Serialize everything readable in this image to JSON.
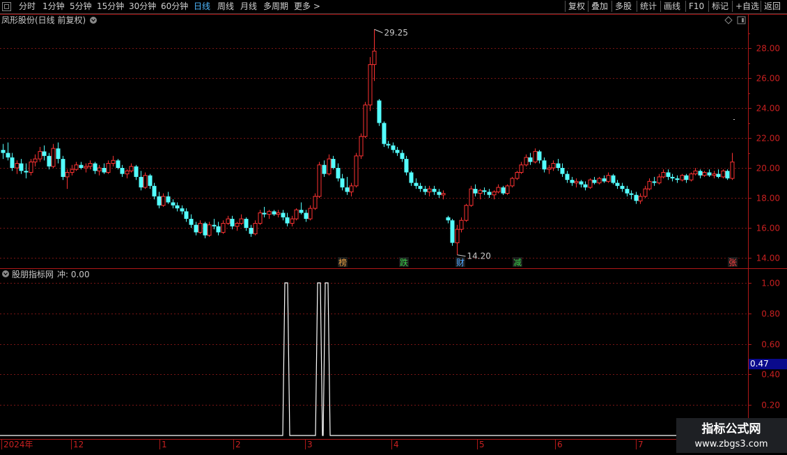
{
  "toolbar": {
    "periods": [
      "分时",
      "1分钟",
      "5分钟",
      "15分钟",
      "30分钟",
      "60分钟",
      "日线",
      "周线",
      "月线",
      "多周期",
      "更多 >"
    ],
    "active_period": "日线",
    "right_buttons": [
      "复权",
      "叠加",
      "多股",
      "统计",
      "画线",
      "F10",
      "标记",
      "+自选",
      "返回"
    ]
  },
  "main_chart": {
    "title": "凤形股份(日线 前复权)",
    "y_ticks": [
      "28.00",
      "26.00",
      "24.00",
      "22.00",
      "20.00",
      "18.00",
      "16.00",
      "14.00"
    ],
    "high_label": "29.25",
    "low_label": "14.20",
    "event_markers": [
      {
        "text": "榜",
        "color": "#e8a040"
      },
      {
        "text": "跌",
        "color": "#39d04a"
      },
      {
        "text": "财",
        "color": "#4da6ff"
      },
      {
        "text": "减",
        "color": "#39d04a"
      },
      {
        "text": "张",
        "color": "#ff4040"
      }
    ]
  },
  "indicator": {
    "title": "股朋指标网",
    "value_label": "冲: 0.00",
    "y_ticks": [
      "1.00",
      "0.80",
      "0.60",
      "0.40",
      "0.20"
    ],
    "cursor_value": "0.47",
    "spikes": [
      {
        "date": "2024-02-27",
        "value": 1.0
      },
      {
        "date": "2024-03-06",
        "value": 1.0
      },
      {
        "date": "2024-03-08",
        "value": 1.0
      }
    ]
  },
  "date_axis": [
    "2024年",
    "12",
    "1",
    "2",
    "3",
    "4",
    "5",
    "6",
    "7"
  ],
  "chart_data": {
    "type": "candlestick",
    "title": "凤形股份(日线 前复权)",
    "ylim": [
      13.3,
      30.0
    ],
    "high_label_value": 29.25,
    "low_label_value": 14.2,
    "ohlc": [
      [
        21.2,
        21.6,
        20.6,
        21.0
      ],
      [
        21.0,
        21.7,
        20.5,
        20.7
      ],
      [
        20.7,
        21.0,
        19.8,
        20.0
      ],
      [
        20.0,
        20.5,
        19.6,
        20.3
      ],
      [
        20.3,
        20.6,
        19.6,
        19.8
      ],
      [
        19.8,
        20.3,
        19.3,
        19.7
      ],
      [
        19.7,
        20.6,
        19.5,
        20.4
      ],
      [
        20.4,
        20.9,
        20.1,
        20.6
      ],
      [
        20.6,
        21.4,
        20.4,
        21.1
      ],
      [
        21.1,
        21.5,
        20.5,
        20.8
      ],
      [
        20.8,
        21.0,
        19.9,
        20.1
      ],
      [
        20.1,
        21.6,
        20.0,
        21.3
      ],
      [
        21.3,
        21.7,
        20.3,
        20.6
      ],
      [
        20.6,
        20.8,
        19.2,
        19.4
      ],
      [
        19.4,
        19.9,
        18.6,
        19.7
      ],
      [
        19.7,
        20.2,
        19.5,
        19.9
      ],
      [
        19.9,
        20.4,
        19.8,
        20.2
      ],
      [
        20.2,
        20.4,
        19.9,
        20.0
      ],
      [
        20.0,
        20.3,
        19.7,
        20.1
      ],
      [
        20.1,
        20.5,
        19.9,
        20.3
      ],
      [
        20.3,
        20.4,
        19.6,
        19.8
      ],
      [
        19.8,
        20.2,
        19.5,
        20.0
      ],
      [
        20.0,
        20.3,
        19.6,
        19.7
      ],
      [
        19.7,
        20.5,
        19.6,
        20.3
      ],
      [
        20.3,
        20.8,
        20.1,
        20.5
      ],
      [
        20.5,
        20.6,
        19.9,
        20.0
      ],
      [
        20.0,
        20.2,
        19.4,
        19.6
      ],
      [
        19.6,
        19.9,
        19.3,
        19.8
      ],
      [
        19.8,
        20.3,
        19.7,
        20.1
      ],
      [
        20.1,
        20.2,
        19.2,
        19.4
      ],
      [
        19.4,
        19.8,
        18.5,
        18.7
      ],
      [
        18.7,
        19.7,
        18.6,
        19.5
      ],
      [
        19.5,
        19.6,
        18.6,
        18.8
      ],
      [
        18.8,
        19.0,
        17.9,
        18.1
      ],
      [
        18.1,
        18.4,
        17.3,
        17.5
      ],
      [
        17.5,
        18.3,
        17.4,
        18.1
      ],
      [
        18.1,
        18.4,
        17.6,
        17.7
      ],
      [
        17.7,
        17.9,
        17.3,
        17.5
      ],
      [
        17.5,
        17.7,
        17.1,
        17.3
      ],
      [
        17.3,
        17.5,
        16.9,
        17.1
      ],
      [
        17.1,
        17.3,
        16.4,
        16.6
      ],
      [
        16.6,
        16.9,
        16.0,
        16.2
      ],
      [
        16.2,
        16.4,
        15.5,
        15.7
      ],
      [
        15.7,
        16.5,
        15.6,
        16.3
      ],
      [
        16.3,
        16.4,
        15.3,
        15.5
      ],
      [
        15.5,
        16.4,
        15.4,
        16.2
      ],
      [
        16.2,
        16.6,
        15.9,
        16.1
      ],
      [
        16.1,
        16.4,
        15.5,
        15.7
      ],
      [
        15.7,
        16.5,
        15.6,
        16.3
      ],
      [
        16.3,
        16.8,
        16.2,
        16.6
      ],
      [
        16.6,
        16.8,
        15.9,
        16.1
      ],
      [
        16.1,
        16.4,
        15.8,
        16.3
      ],
      [
        16.3,
        16.9,
        16.2,
        16.6
      ],
      [
        16.6,
        16.7,
        15.8,
        16.0
      ],
      [
        16.0,
        16.2,
        15.4,
        15.6
      ],
      [
        15.6,
        16.5,
        15.5,
        16.3
      ],
      [
        16.3,
        17.2,
        16.2,
        17.0
      ],
      [
        17.0,
        17.4,
        16.7,
        16.9
      ],
      [
        16.9,
        17.2,
        16.6,
        17.1
      ],
      [
        17.1,
        17.2,
        16.8,
        16.9
      ],
      [
        16.9,
        17.2,
        16.7,
        17.0
      ],
      [
        17.0,
        17.2,
        16.5,
        16.7
      ],
      [
        16.7,
        17.0,
        16.1,
        16.3
      ],
      [
        16.3,
        16.8,
        16.1,
        16.6
      ],
      [
        16.6,
        17.3,
        16.5,
        17.2
      ],
      [
        17.2,
        17.7,
        16.9,
        17.0
      ],
      [
        17.0,
        17.2,
        16.4,
        16.6
      ],
      [
        16.6,
        17.5,
        16.5,
        17.3
      ],
      [
        17.3,
        18.3,
        17.2,
        18.1
      ],
      [
        18.1,
        20.4,
        18.0,
        20.2
      ],
      [
        20.2,
        20.5,
        19.4,
        19.6
      ],
      [
        19.6,
        20.9,
        19.5,
        20.6
      ],
      [
        20.6,
        20.8,
        19.9,
        20.0
      ],
      [
        20.0,
        20.3,
        19.1,
        19.3
      ],
      [
        19.3,
        19.6,
        18.5,
        18.7
      ],
      [
        18.7,
        19.4,
        18.2,
        18.4
      ],
      [
        18.4,
        19.0,
        18.1,
        18.8
      ],
      [
        18.8,
        21.0,
        18.7,
        20.8
      ],
      [
        20.8,
        22.3,
        20.6,
        22.1
      ],
      [
        22.1,
        24.4,
        22.0,
        24.2
      ],
      [
        24.2,
        27.4,
        23.8,
        26.9
      ],
      [
        26.9,
        29.25,
        25.8,
        27.8
      ],
      [
        24.5,
        24.6,
        22.8,
        23.0
      ],
      [
        23.0,
        23.1,
        21.4,
        21.6
      ],
      [
        21.6,
        21.8,
        21.3,
        21.5
      ],
      [
        21.5,
        21.7,
        21.0,
        21.2
      ],
      [
        21.2,
        21.4,
        20.8,
        21.0
      ],
      [
        21.0,
        21.2,
        20.4,
        20.6
      ],
      [
        20.6,
        20.8,
        19.5,
        19.7
      ],
      [
        19.7,
        19.8,
        18.8,
        19.0
      ],
      [
        19.0,
        19.3,
        18.6,
        18.8
      ],
      [
        18.8,
        19.0,
        18.4,
        18.6
      ],
      [
        18.6,
        18.8,
        18.2,
        18.4
      ],
      [
        18.4,
        18.8,
        18.1,
        18.6
      ],
      [
        18.6,
        18.8,
        18.2,
        18.4
      ],
      [
        18.4,
        18.6,
        18.0,
        18.2
      ],
      [
        18.2,
        18.5,
        17.9,
        18.3
      ],
      [
        16.7,
        16.8,
        16.3,
        16.5
      ],
      [
        16.5,
        16.6,
        14.8,
        15.0
      ],
      [
        15.0,
        16.2,
        14.2,
        15.9
      ],
      [
        15.9,
        16.7,
        15.7,
        16.5
      ],
      [
        16.5,
        17.6,
        16.4,
        17.5
      ],
      [
        17.5,
        18.8,
        17.4,
        18.6
      ],
      [
        18.6,
        18.9,
        18.1,
        18.3
      ],
      [
        18.3,
        18.6,
        17.9,
        18.5
      ],
      [
        18.5,
        18.7,
        18.2,
        18.4
      ],
      [
        18.4,
        18.6,
        18.0,
        18.2
      ],
      [
        18.2,
        18.5,
        17.9,
        18.4
      ],
      [
        18.4,
        18.9,
        18.3,
        18.7
      ],
      [
        18.7,
        18.8,
        18.2,
        18.3
      ],
      [
        18.3,
        18.9,
        18.2,
        18.8
      ],
      [
        18.8,
        19.4,
        18.7,
        19.3
      ],
      [
        19.3,
        19.8,
        19.2,
        19.7
      ],
      [
        19.7,
        20.4,
        19.6,
        20.2
      ],
      [
        20.2,
        20.9,
        20.1,
        20.7
      ],
      [
        20.7,
        21.0,
        20.2,
        20.4
      ],
      [
        20.4,
        21.3,
        20.3,
        21.1
      ],
      [
        21.1,
        21.2,
        20.3,
        20.5
      ],
      [
        20.5,
        20.7,
        19.7,
        19.9
      ],
      [
        19.9,
        20.2,
        19.6,
        20.0
      ],
      [
        20.0,
        20.5,
        19.8,
        20.3
      ],
      [
        20.3,
        20.6,
        19.8,
        20.0
      ],
      [
        20.0,
        20.3,
        19.4,
        19.6
      ],
      [
        19.6,
        19.8,
        19.0,
        19.2
      ],
      [
        19.2,
        19.4,
        18.8,
        19.0
      ],
      [
        19.0,
        19.3,
        18.7,
        19.1
      ],
      [
        19.1,
        19.2,
        18.7,
        18.9
      ],
      [
        18.9,
        19.1,
        18.5,
        18.7
      ],
      [
        18.7,
        19.3,
        18.6,
        19.2
      ],
      [
        19.2,
        19.4,
        18.9,
        19.0
      ],
      [
        19.0,
        19.4,
        18.9,
        19.3
      ],
      [
        19.3,
        19.5,
        19.0,
        19.1
      ],
      [
        19.1,
        19.7,
        19.0,
        19.5
      ],
      [
        19.5,
        19.6,
        18.9,
        19.0
      ],
      [
        19.0,
        19.2,
        18.6,
        18.8
      ],
      [
        18.8,
        19.0,
        18.4,
        18.6
      ],
      [
        18.6,
        18.8,
        18.1,
        18.3
      ],
      [
        18.3,
        18.5,
        17.9,
        18.2
      ],
      [
        18.2,
        18.4,
        17.6,
        17.8
      ],
      [
        17.8,
        18.3,
        17.6,
        18.1
      ],
      [
        18.1,
        18.8,
        18.0,
        18.6
      ],
      [
        18.6,
        19.3,
        18.5,
        19.1
      ],
      [
        19.1,
        19.4,
        18.8,
        19.0
      ],
      [
        19.0,
        19.6,
        18.9,
        19.4
      ],
      [
        19.4,
        19.9,
        19.3,
        19.7
      ],
      [
        19.7,
        19.9,
        19.2,
        19.4
      ],
      [
        19.4,
        19.6,
        19.1,
        19.3
      ],
      [
        19.3,
        19.5,
        19.0,
        19.2
      ],
      [
        19.2,
        19.6,
        19.1,
        19.5
      ],
      [
        19.5,
        19.6,
        19.0,
        19.2
      ],
      [
        19.2,
        19.7,
        19.1,
        19.6
      ],
      [
        19.6,
        20.0,
        19.5,
        19.8
      ],
      [
        19.8,
        19.9,
        19.3,
        19.5
      ],
      [
        19.5,
        19.8,
        19.4,
        19.7
      ],
      [
        19.7,
        19.9,
        19.4,
        19.5
      ],
      [
        19.5,
        19.8,
        19.3,
        19.6
      ],
      [
        19.6,
        19.9,
        19.3,
        19.4
      ],
      [
        19.4,
        19.9,
        19.3,
        19.8
      ],
      [
        19.8,
        19.9,
        19.2,
        19.3
      ],
      [
        19.3,
        21.0,
        19.2,
        20.4
      ]
    ]
  }
}
